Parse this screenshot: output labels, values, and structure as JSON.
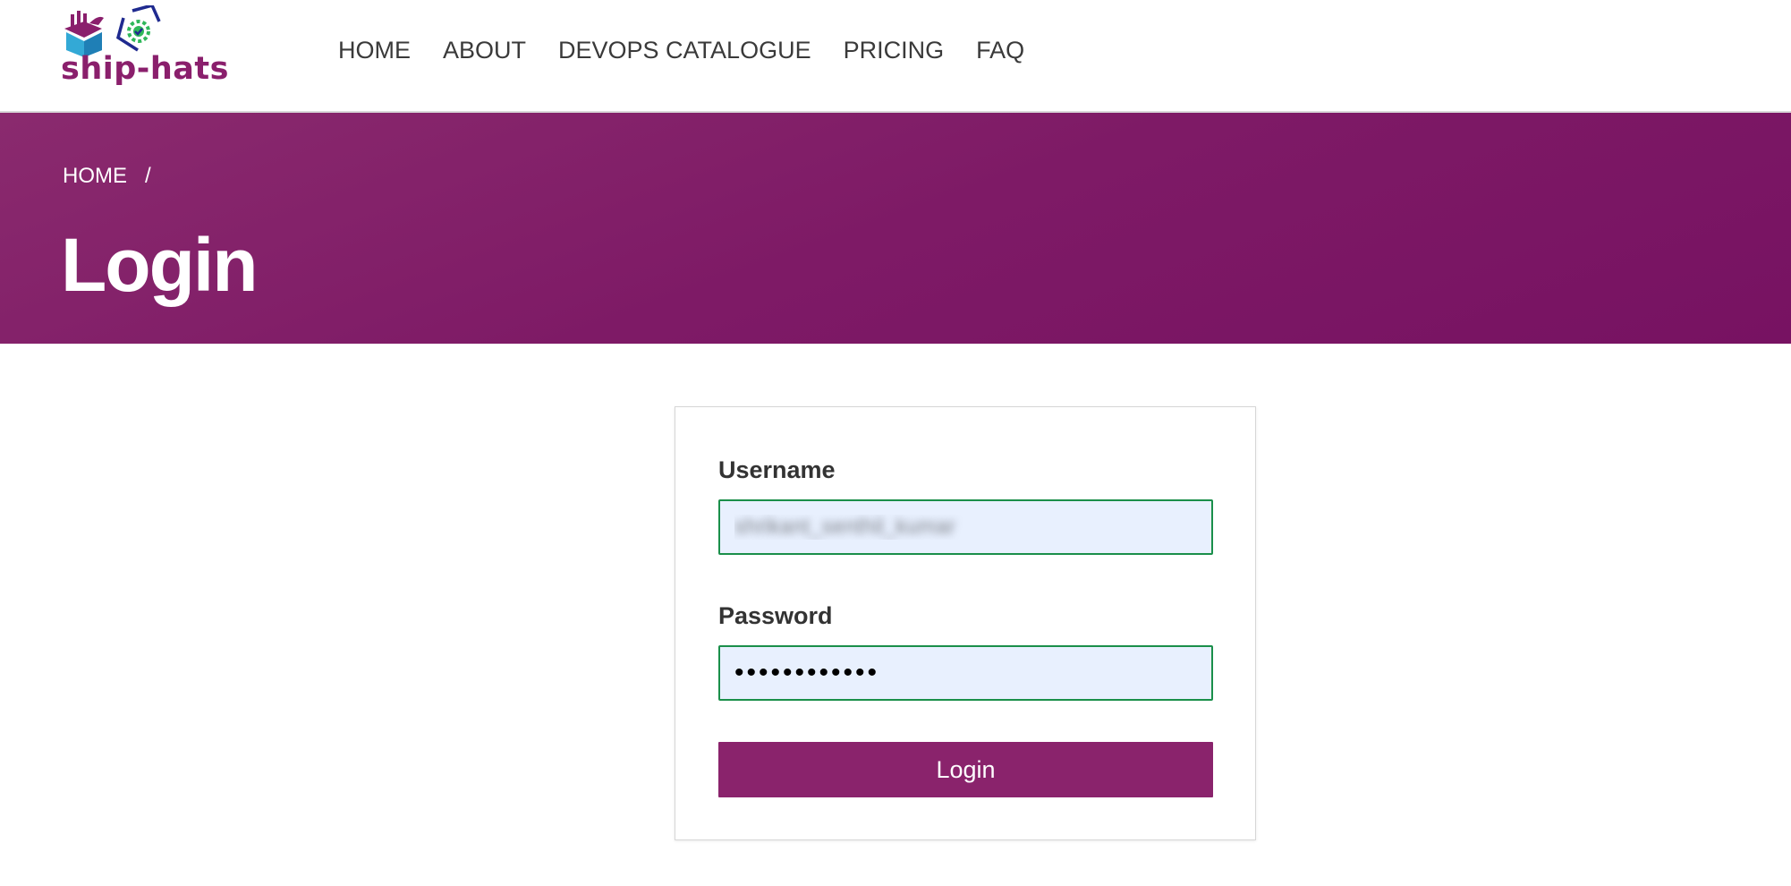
{
  "brand": {
    "name": "ship-hats",
    "primary_color": "#8a1f6c",
    "icons": [
      "ship-icon",
      "hex-gear-check-icon"
    ]
  },
  "nav": {
    "items": [
      {
        "label": "HOME"
      },
      {
        "label": "ABOUT"
      },
      {
        "label": "DEVOPS CATALOGUE"
      },
      {
        "label": "PRICING"
      },
      {
        "label": "FAQ"
      }
    ]
  },
  "hero": {
    "breadcrumb": {
      "home": "HOME",
      "separator": "/"
    },
    "title": "Login"
  },
  "form": {
    "username_label": "Username",
    "username_value": "shrikant_senthil_kumar",
    "password_label": "Password",
    "password_value": "••••••••••••",
    "submit_label": "Login",
    "field_border_color": "#1a8f4a",
    "field_bg_color": "#e8f0fe"
  }
}
